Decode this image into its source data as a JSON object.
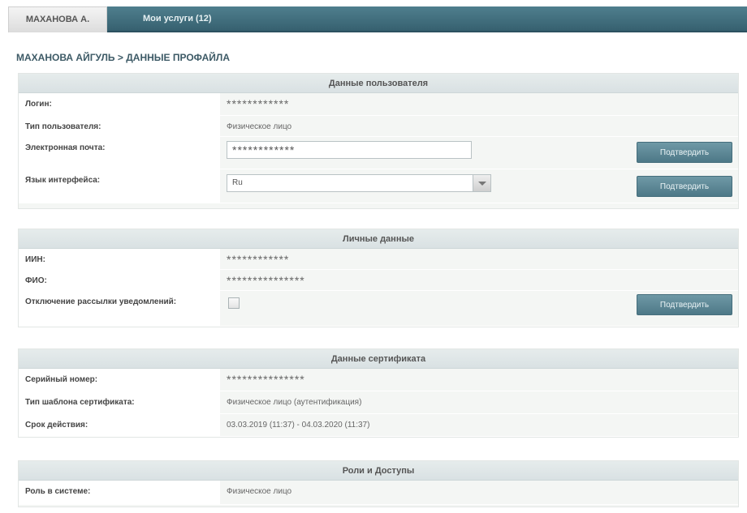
{
  "tabs": [
    {
      "label": "МАХАНОВА А."
    },
    {
      "label": "Мои услуги (12)"
    }
  ],
  "page_title": "МАХАНОВА АЙГУЛЬ > ДАННЫЕ ПРОФАЙЛА",
  "user_data": {
    "header": "Данные пользователя",
    "login_label": "Логин:",
    "login_value": "************",
    "user_type_label": "Тип пользователя:",
    "user_type_value": "Физическое лицо",
    "email_label": "Электронная почта:",
    "email_value": "************",
    "email_button": "Подтвердить",
    "lang_label": "Язык интерфейса:",
    "lang_value": "Ru",
    "lang_button": "Подтвердить"
  },
  "personal_data": {
    "header": "Личные данные",
    "iin_label": "ИИН:",
    "iin_value": "************",
    "fio_label": "ФИО:",
    "fio_value": "***************",
    "notify_label": "Отключение рассылки уведомлений:",
    "notify_checked": false,
    "notify_button": "Подтвердить"
  },
  "cert_data": {
    "header": "Данные сертификата",
    "serial_label": "Серийный номер:",
    "serial_value": "***************",
    "template_label": "Тип шаблона сертификата:",
    "template_value": "Физическое лицо (аутентификация)",
    "validity_label": "Срок действия:",
    "validity_value": "03.03.2019 (11:37) - 04.03.2020 (11:37)"
  },
  "roles": {
    "header": "Роли и Доступы",
    "role_label": "Роль в системе:",
    "role_value": "Физическое лицо"
  },
  "colors": {
    "tabbar": "#3f6f7e",
    "button": "#5d8796",
    "panel_header": "#dfe6e8"
  }
}
